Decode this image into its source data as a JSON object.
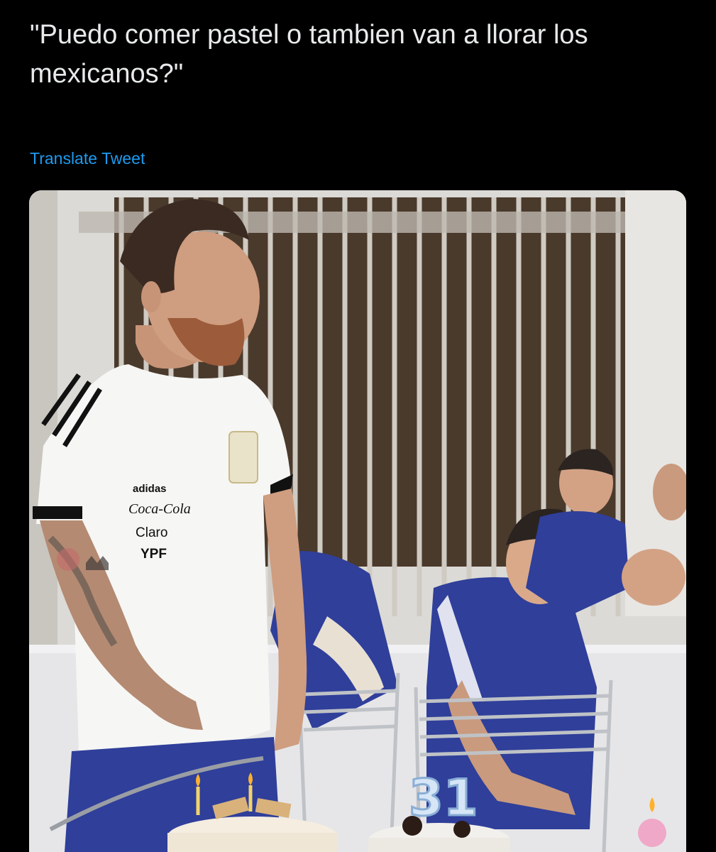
{
  "tweet": {
    "text": "\"Puedo comer pastel o tambien van a llorar los mexicanos?\"",
    "translate_label": "Translate Tweet"
  },
  "photo": {
    "shirt_sponsors": [
      "adidas",
      "Coca-Cola",
      "Claro",
      "YPF"
    ],
    "candle_number": "31",
    "colors": {
      "background": "#000000",
      "text": "#e7e9ea",
      "link": "#1d9bf0",
      "jersey_blue": "#2f3f9a",
      "shirt_white": "#f6f6f4"
    }
  }
}
